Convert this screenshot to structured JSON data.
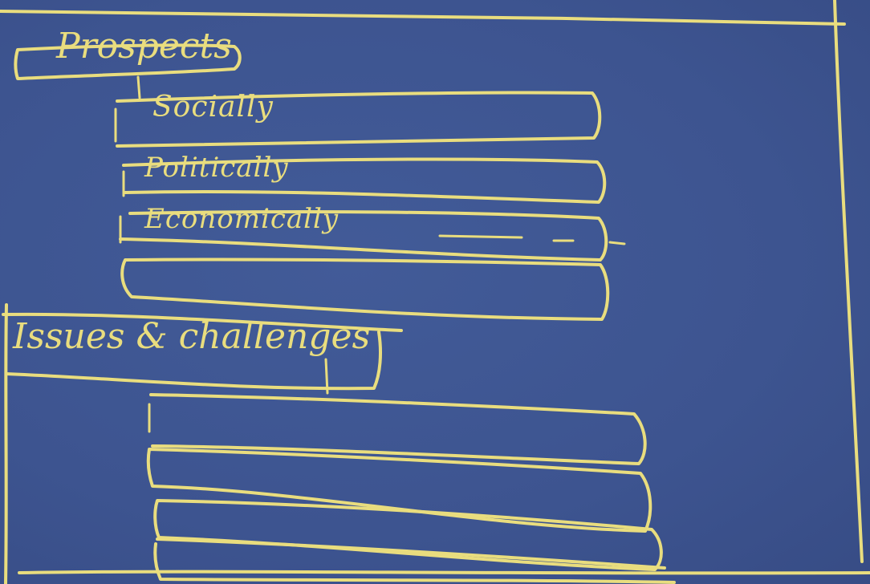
{
  "board": {
    "chalk_color": "#e9dd7e",
    "background_color": "#3e5590"
  },
  "prospects": {
    "heading": "Prospects",
    "items": [
      {
        "label": "Socially"
      },
      {
        "label": "Politically"
      },
      {
        "label": "Economically"
      },
      {
        "label": ""
      }
    ]
  },
  "issues": {
    "heading": "Issues & challenges",
    "items": [
      {
        "label": ""
      },
      {
        "label": ""
      },
      {
        "label": ""
      },
      {
        "label": ""
      }
    ]
  }
}
